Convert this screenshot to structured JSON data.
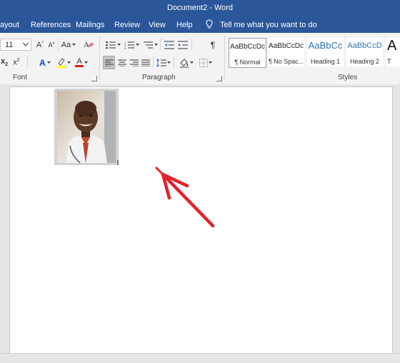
{
  "window": {
    "title": "Document2  -  Word"
  },
  "tabs": [
    "ayout",
    "References",
    "Mailings",
    "Review",
    "View",
    "Help"
  ],
  "tell_me": {
    "placeholder": "Tell me what you want to do"
  },
  "font_group": {
    "label": "Font",
    "font_size": "11",
    "change_case": "Aa",
    "subscript": "x",
    "subscript_sub": "2",
    "superscript": "x",
    "superscript_sup": "2",
    "font_color_letter": "A",
    "effects_letter": "A"
  },
  "paragraph_group": {
    "label": "Paragraph",
    "pilcrow": "¶"
  },
  "styles_group": {
    "label": "Styles",
    "items": [
      {
        "sample": "AaBbCcDc",
        "name": "¶ Normal"
      },
      {
        "sample": "AaBbCcDc",
        "name": "¶ No Spac..."
      },
      {
        "sample": "AaBbCc",
        "name": "Heading 1"
      },
      {
        "sample": "AaBbCcD",
        "name": "Heading 2"
      },
      {
        "sample": "A",
        "name": "T"
      }
    ]
  },
  "colors": {
    "accent": "#2b579a",
    "ribbon": "#f3f3f3",
    "arrow": "#e3222b",
    "highlight": "#ffff00",
    "font_color": "#d11f1f"
  },
  "icons": [
    "lightbulb-icon",
    "bullets-icon",
    "numbering-icon",
    "multilevel-list-icon",
    "decrease-indent-icon",
    "increase-indent-icon",
    "show-formatting-icon",
    "clear-formatting-icon",
    "align-left-icon",
    "align-center-icon",
    "align-right-icon",
    "justify-icon",
    "line-spacing-icon",
    "shading-icon",
    "borders-icon",
    "text-effects-icon",
    "highlighter-icon",
    "font-color-icon",
    "grow-font-icon",
    "shrink-font-icon",
    "dropdown-arrow-icon",
    "red-arrow-annotation"
  ]
}
